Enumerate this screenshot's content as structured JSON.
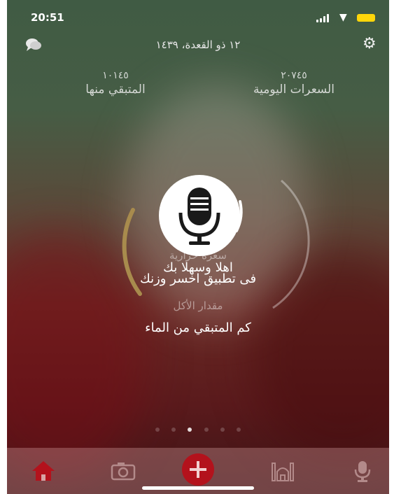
{
  "status": {
    "time": "20:51",
    "colors": {
      "battery": "#ffd60a"
    }
  },
  "header": {
    "date": "١٢ ذو القعدة، ١٤٣٩",
    "chat_icon": "chat-bubbles-icon",
    "settings_icon": "gear-icon"
  },
  "stats": {
    "remaining": {
      "value": "١٠١٤٥",
      "label": "المتبقي منها"
    },
    "daily": {
      "value": "٢٠٧٤٥",
      "label": "السعرات اليومية"
    }
  },
  "main": {
    "ring_label": "سعرة حرارية",
    "welcome_line1": "اهلا وسهلا بك",
    "welcome_line2": "فى تطبيق اخسر وزنك",
    "food_amount_label": "مقدار الأكل",
    "water_question": "كم المتبقي من الماء",
    "mic_icon": "microphone-icon"
  },
  "pager": {
    "count": 6,
    "active_index": 2
  },
  "tabs": [
    {
      "icon": "home-icon"
    },
    {
      "icon": "camera-icon"
    },
    {
      "icon": "add-icon"
    },
    {
      "icon": "mosque-icon"
    },
    {
      "icon": "microphone-icon"
    }
  ],
  "colors": {
    "accent_red": "#b3121c",
    "ring_gold": "#a88b4d"
  }
}
